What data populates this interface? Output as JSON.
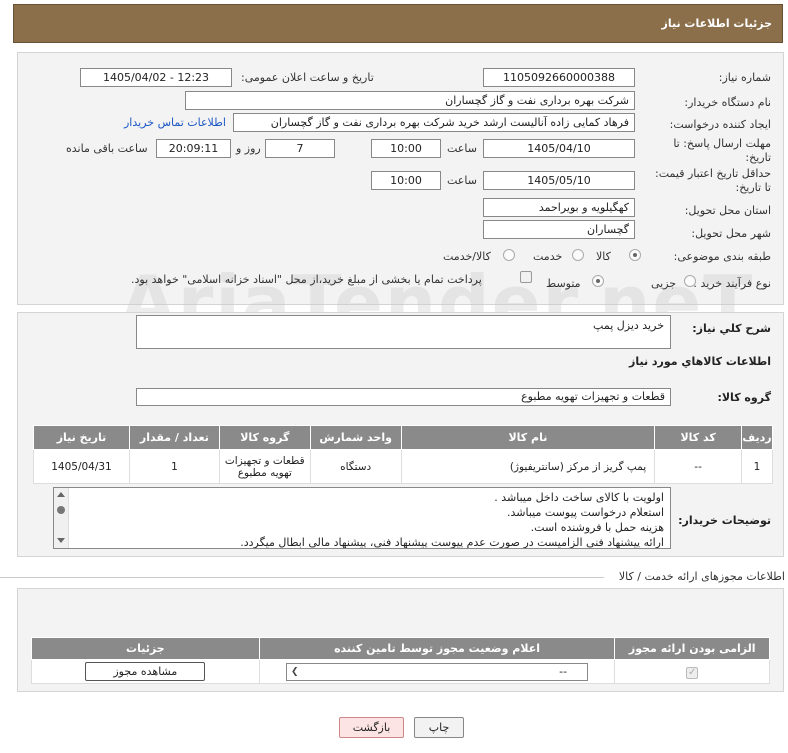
{
  "header": {
    "title": "جزئیات اطلاعات نیاز"
  },
  "form": {
    "need_number_label": "شماره نیاز:",
    "need_number": "1105092660000388",
    "announce_label": "تاریخ و ساعت اعلان عمومی:",
    "announce_value": "1405/04/02 - 12:23",
    "buyer_org_label": "نام دستگاه خریدار:",
    "buyer_org": "شرکت بهره برداری نفت و گاز گچساران",
    "creator_label": "ایجاد کننده درخواست:",
    "creator": "فرهاد کمایی زاده آنالیست ارشد خرید شرکت بهره برداری نفت و گاز گچساران",
    "contact_link": "اطلاعات تماس خریدار",
    "deadline_label_1": "مهلت ارسال پاسخ: تا",
    "deadline_label_2": "تاریخ:",
    "deadline_date": "1405/04/10",
    "time_label": "ساعت",
    "deadline_time": "10:00",
    "days_value": "7",
    "days_label": "روز و",
    "remaining_time": "20:09:11",
    "remaining_label": "ساعت باقی مانده",
    "min_validity_label_1": "حداقل تاریخ اعتبار قیمت:",
    "min_validity_label_2": "تا تاریخ:",
    "validity_date": "1405/05/10",
    "validity_time": "10:00",
    "province_label": "استان محل تحویل:",
    "province": "کهگیلویه و بویراحمد",
    "city_label": "شهر محل تحویل:",
    "city": "گچساران",
    "category_label": "طبقه بندی موضوعی:",
    "category_options": [
      "کالا",
      "خدمت",
      "کالا/خدمت"
    ],
    "process_label": "نوع فرآیند خرید :",
    "process_options": [
      "جزیی",
      "متوسط"
    ],
    "payment_note": "پرداخت تمام یا بخشی از مبلغ خرید،از محل \"اسناد خزانه اسلامی\" خواهد بود."
  },
  "summary": {
    "label": "شرح کلي نياز:",
    "value": "خرید دیزل پمپ"
  },
  "goods": {
    "section_title": "اطلاعات کالاهاي مورد نياز",
    "group_label": "گروه کالا:",
    "group_value": "قطعات و تجهیزات تهویه مطبوع",
    "columns": [
      "ردیف",
      "کد کالا",
      "نام کالا",
      "واحد شمارش",
      "گروه کالا",
      "تعداد / مقدار",
      "تاریخ نیاز"
    ],
    "rows": [
      [
        "1",
        "--",
        "پمپ گریز از مرکز (سانتریفیوژ)",
        "دستگاه",
        "قطعات و تجهیزات تهویه مطبوع",
        "1",
        "1405/04/31"
      ]
    ]
  },
  "buyer_notes": {
    "label": "توضیحات خریدار:",
    "lines": [
      "اولویت با کالای ساخت داخل میباشد .",
      "استعلام درخواست پیوست میباشد.",
      "هزینه حمل با فروشنده است.",
      "ارائه پیشنهاد فنی الزامیست در صورت عدم پیوست پیشنهاد فنی، پیشنهاد مالی ابطال میگردد."
    ]
  },
  "licenses": {
    "section_title": "اطلاعات مجوزهای ارائه خدمت / کالا",
    "columns": [
      "الزامی بودن ارائه مجوز",
      "اعلام وضعیت مجوز توسط تامین کننده",
      "جزئیات"
    ],
    "select_value": "--",
    "view_button": "مشاهده مجوز"
  },
  "buttons": {
    "print": "چاپ",
    "back": "بازگشت"
  }
}
